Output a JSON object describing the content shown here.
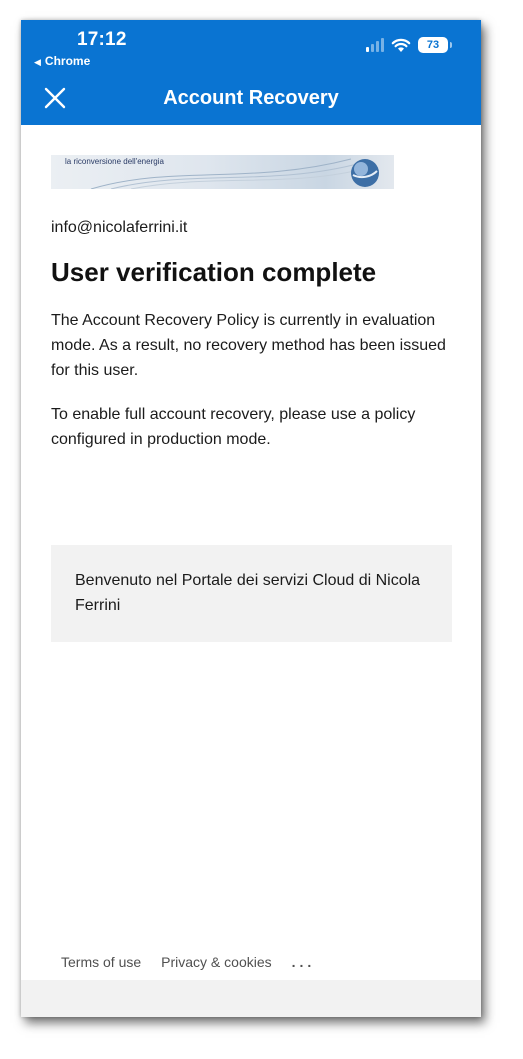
{
  "status_bar": {
    "time": "17:12",
    "back_app": "Chrome",
    "battery": "73"
  },
  "header": {
    "title": "Account Recovery",
    "close_icon": "close-icon",
    "color": "#0a74d2"
  },
  "banner": {
    "tagline": "la riconversione dell'energia"
  },
  "main": {
    "email": "info@nicolaferrini.it",
    "heading": "User verification complete",
    "paragraph_1": "The Account Recovery Policy is currently in evaluation mode. As a result, no recovery method has been issued for this user.",
    "paragraph_2": "To enable full account recovery, please use a policy configured in production mode."
  },
  "info_box": {
    "text": "Benvenuto nel Portale dei servizi Cloud di Nicola Ferrini"
  },
  "footer": {
    "terms": "Terms of use",
    "privacy": "Privacy & cookies",
    "more": "..."
  }
}
